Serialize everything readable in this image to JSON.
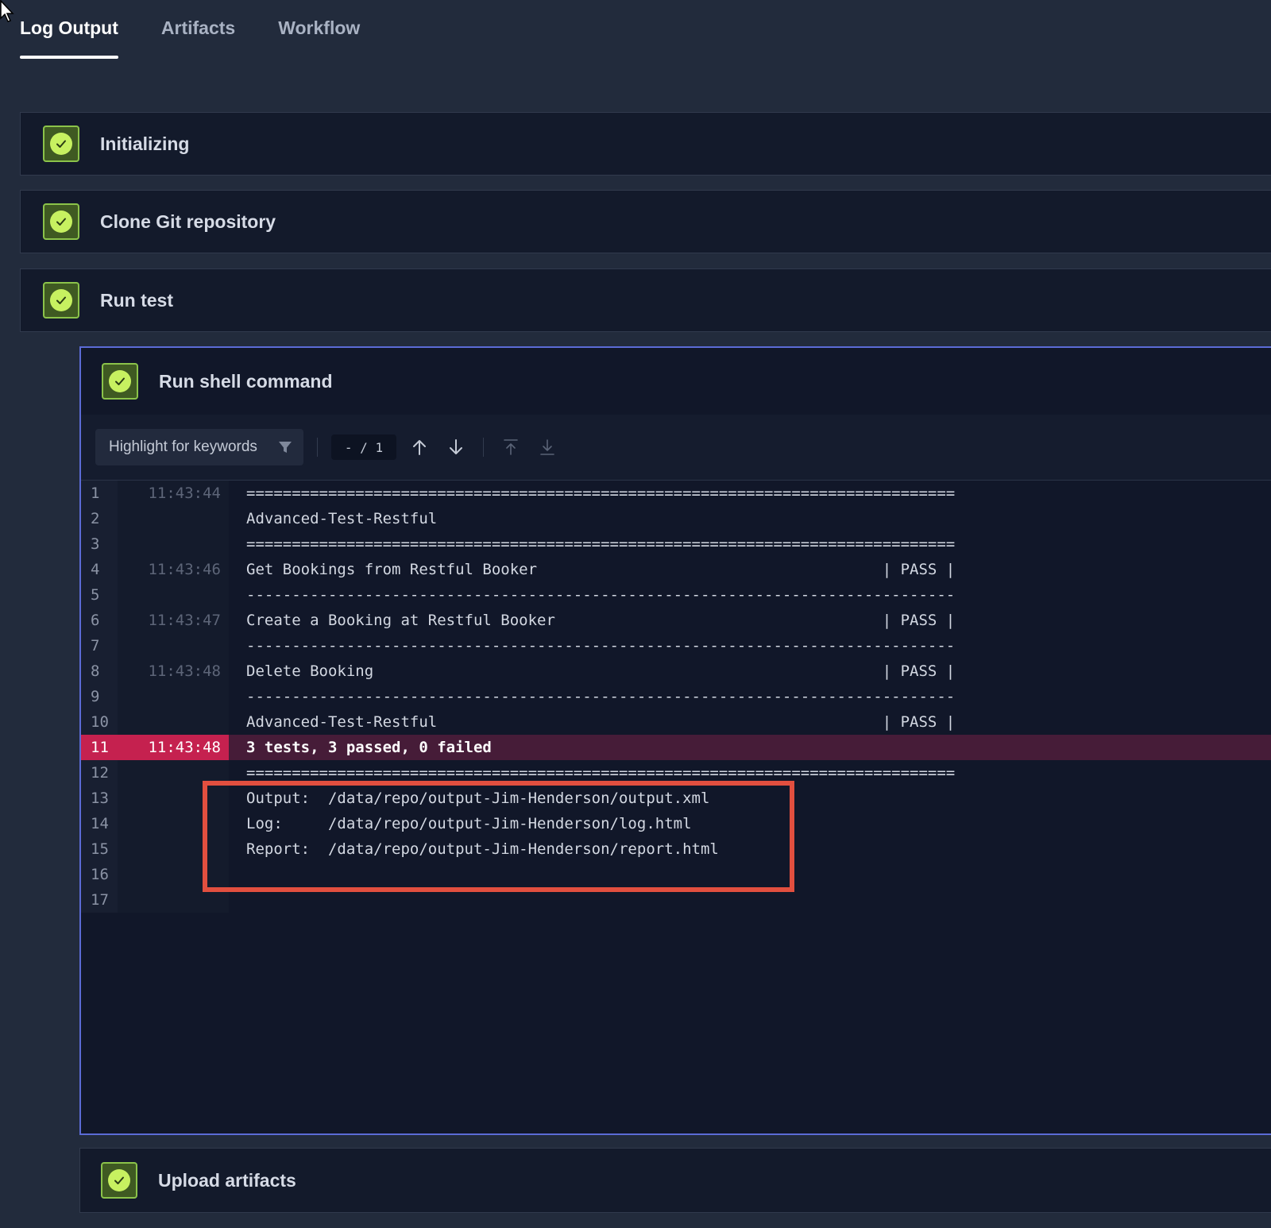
{
  "tabs": [
    {
      "label": "Log Output",
      "active": true
    },
    {
      "label": "Artifacts",
      "active": false
    },
    {
      "label": "Workflow",
      "active": false
    }
  ],
  "steps": {
    "initializing": "Initializing",
    "clone": "Clone Git repository",
    "run_test": "Run test",
    "shell": "Run shell command",
    "upload": "Upload artifacts"
  },
  "toolbar": {
    "keyword_placeholder": "Highlight for keywords",
    "match_counter": "- / 1"
  },
  "log_lines": [
    {
      "n": "1",
      "t": "11:43:44",
      "text": "=============================================================================="
    },
    {
      "n": "2",
      "t": "",
      "text": "Advanced-Test-Restful"
    },
    {
      "n": "3",
      "t": "",
      "text": "=============================================================================="
    },
    {
      "n": "4",
      "t": "11:43:46",
      "text": "Get Bookings from Restful Booker                                      | PASS |"
    },
    {
      "n": "5",
      "t": "",
      "text": "------------------------------------------------------------------------------"
    },
    {
      "n": "6",
      "t": "11:43:47",
      "text": "Create a Booking at Restful Booker                                    | PASS |"
    },
    {
      "n": "7",
      "t": "",
      "text": "------------------------------------------------------------------------------"
    },
    {
      "n": "8",
      "t": "11:43:48",
      "text": "Delete Booking                                                        | PASS |"
    },
    {
      "n": "9",
      "t": "",
      "text": "------------------------------------------------------------------------------"
    },
    {
      "n": "10",
      "t": "",
      "text": "Advanced-Test-Restful                                                 | PASS |"
    },
    {
      "n": "11",
      "t": "11:43:48",
      "text": "3 tests, 3 passed, 0 failed"
    },
    {
      "n": "12",
      "t": "",
      "text": "=============================================================================="
    },
    {
      "n": "13",
      "t": "",
      "text": "Output:  /data/repo/output-Jim-Henderson/output.xml"
    },
    {
      "n": "14",
      "t": "",
      "text": "Log:     /data/repo/output-Jim-Henderson/log.html"
    },
    {
      "n": "15",
      "t": "",
      "text": "Report:  /data/repo/output-Jim-Henderson/report.html"
    },
    {
      "n": "16",
      "t": "",
      "text": ""
    },
    {
      "n": "17",
      "t": "",
      "text": ""
    }
  ],
  "highlighted_line": "11",
  "colors": {
    "success_green": "#8bc34a",
    "highlight_row": "#c5214f",
    "active_border": "#5b6bd6",
    "annotation_red": "#e24f3f"
  }
}
